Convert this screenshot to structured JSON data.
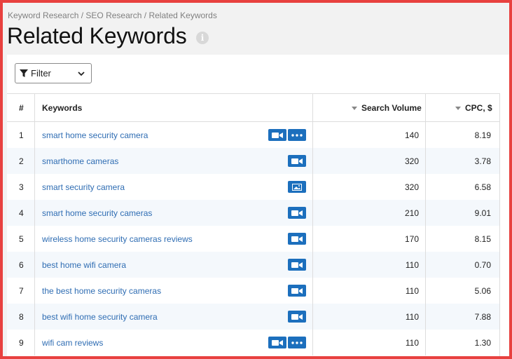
{
  "breadcrumb": {
    "items": [
      "Keyword Research",
      "SEO Research",
      "Related Keywords"
    ],
    "separator": " / "
  },
  "page_title": "Related Keywords",
  "info_icon_label": "i",
  "filter": {
    "label": "Filter"
  },
  "table": {
    "headers": {
      "index": "#",
      "keyword": "Keywords",
      "volume": "Search Volume",
      "cpc": "CPC, $"
    },
    "rows": [
      {
        "index": "1",
        "keyword": "smart home security camera",
        "volume": "140",
        "cpc": "8.19",
        "features": [
          "video-icon",
          "more-icon"
        ]
      },
      {
        "index": "2",
        "keyword": "smarthome cameras",
        "volume": "320",
        "cpc": "3.78",
        "features": [
          "video-icon"
        ]
      },
      {
        "index": "3",
        "keyword": "smart security camera",
        "volume": "320",
        "cpc": "6.58",
        "features": [
          "image-icon"
        ]
      },
      {
        "index": "4",
        "keyword": "smart home security cameras",
        "volume": "210",
        "cpc": "9.01",
        "features": [
          "video-icon"
        ]
      },
      {
        "index": "5",
        "keyword": "wireless home security cameras reviews",
        "volume": "170",
        "cpc": "8.15",
        "features": [
          "video-icon"
        ]
      },
      {
        "index": "6",
        "keyword": "best home wifi camera",
        "volume": "110",
        "cpc": "0.70",
        "features": [
          "video-icon"
        ]
      },
      {
        "index": "7",
        "keyword": "the best home security cameras",
        "volume": "110",
        "cpc": "5.06",
        "features": [
          "video-icon"
        ]
      },
      {
        "index": "8",
        "keyword": "best wifi home security camera",
        "volume": "110",
        "cpc": "7.88",
        "features": [
          "video-icon"
        ]
      },
      {
        "index": "9",
        "keyword": "wifi cam reviews",
        "volume": "110",
        "cpc": "1.30",
        "features": [
          "video-icon",
          "more-icon"
        ]
      }
    ]
  },
  "colors": {
    "border": "#e8413f",
    "link": "#2f6db3",
    "badge": "#1c6fbd",
    "alt_row": "#f4f8fc"
  }
}
